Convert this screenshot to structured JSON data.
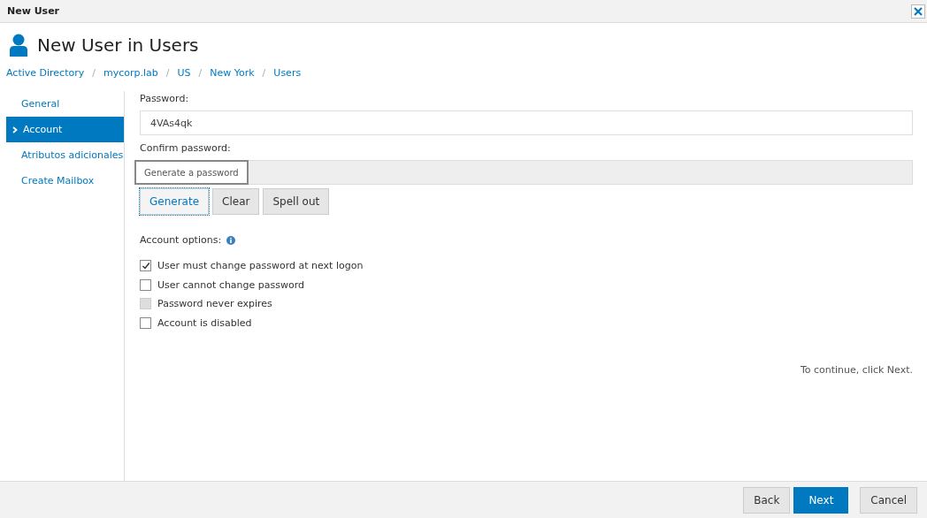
{
  "window": {
    "title": "New User"
  },
  "header": {
    "title": "New User in Users"
  },
  "breadcrumb": {
    "separator": "/",
    "items": [
      "Active Directory",
      "mycorp.lab",
      "US",
      "New York",
      "Users"
    ]
  },
  "sidebar": {
    "items": [
      {
        "label": "General",
        "selected": false
      },
      {
        "label": "Account",
        "selected": true
      },
      {
        "label": "Atributos adicionales",
        "selected": false
      },
      {
        "label": "Create Mailbox",
        "selected": false
      }
    ]
  },
  "password": {
    "label": "Password:",
    "value": "4VAs4qk"
  },
  "confirm_password": {
    "label": "Confirm password:",
    "disabled": true,
    "tooltip": "Generate a password"
  },
  "password_buttons": [
    {
      "label": "Generate",
      "focused": true
    },
    {
      "label": "Clear",
      "focused": false
    },
    {
      "label": "Spell out",
      "focused": false
    }
  ],
  "account_options": {
    "label": "Account options:",
    "options": [
      {
        "label": "User must change password at next logon",
        "checked": true,
        "disabled": false
      },
      {
        "label": "User cannot change password",
        "checked": false,
        "disabled": false
      },
      {
        "label": "Password never expires",
        "checked": false,
        "disabled": true
      },
      {
        "label": "Account is disabled",
        "checked": false,
        "disabled": false
      }
    ]
  },
  "hint": "To continue, click Next.",
  "footer_buttons": [
    {
      "label": "Back",
      "primary": false
    },
    {
      "label": "Next",
      "primary": true
    },
    {
      "label": "Cancel",
      "primary": false
    }
  ]
}
